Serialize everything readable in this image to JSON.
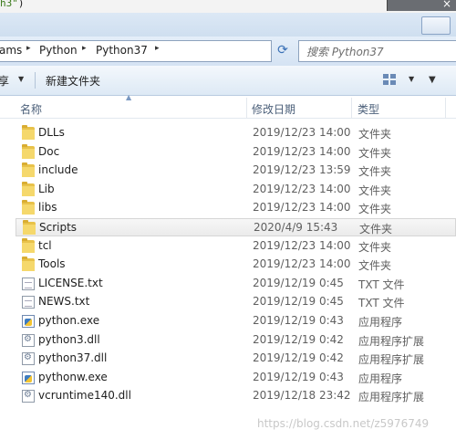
{
  "code": {
    "text_a": "h3\"",
    "text_b": ")"
  },
  "window": {
    "close_glyph": "×"
  },
  "address_bar": {
    "crumbs": [
      "ams",
      "Python",
      "Python37"
    ],
    "separator_glyph": "▸"
  },
  "search": {
    "placeholder": "搜索 Python37"
  },
  "toolbar": {
    "share_label": "享",
    "new_folder_label": "新建文件夹"
  },
  "columns": {
    "name": "名称",
    "date": "修改日期",
    "type": "类型"
  },
  "files": [
    {
      "name": "DLLs",
      "date": "2019/12/23 14:00",
      "type": "文件夹",
      "icon": "folder-icon"
    },
    {
      "name": "Doc",
      "date": "2019/12/23 14:00",
      "type": "文件夹",
      "icon": "folder-icon"
    },
    {
      "name": "include",
      "date": "2019/12/23 13:59",
      "type": "文件夹",
      "icon": "folder-icon"
    },
    {
      "name": "Lib",
      "date": "2019/12/23 14:00",
      "type": "文件夹",
      "icon": "folder-icon"
    },
    {
      "name": "libs",
      "date": "2019/12/23 14:00",
      "type": "文件夹",
      "icon": "folder-icon"
    },
    {
      "name": "Scripts",
      "date": "2020/4/9 15:43",
      "type": "文件夹",
      "icon": "folder-icon",
      "selected": true
    },
    {
      "name": "tcl",
      "date": "2019/12/23 14:00",
      "type": "文件夹",
      "icon": "folder-icon"
    },
    {
      "name": "Tools",
      "date": "2019/12/23 14:00",
      "type": "文件夹",
      "icon": "folder-icon"
    },
    {
      "name": "LICENSE.txt",
      "date": "2019/12/19 0:45",
      "type": "TXT 文件",
      "icon": "text-file-icon"
    },
    {
      "name": "NEWS.txt",
      "date": "2019/12/19 0:45",
      "type": "TXT 文件",
      "icon": "text-file-icon"
    },
    {
      "name": "python.exe",
      "date": "2019/12/19 0:43",
      "type": "应用程序",
      "icon": "python-exe-icon"
    },
    {
      "name": "python3.dll",
      "date": "2019/12/19 0:42",
      "type": "应用程序扩展",
      "icon": "dll-file-icon"
    },
    {
      "name": "python37.dll",
      "date": "2019/12/19 0:42",
      "type": "应用程序扩展",
      "icon": "dll-file-icon"
    },
    {
      "name": "pythonw.exe",
      "date": "2019/12/19 0:43",
      "type": "应用程序",
      "icon": "python-exe-icon"
    },
    {
      "name": "vcruntime140.dll",
      "date": "2019/12/18 23:42",
      "type": "应用程序扩展",
      "icon": "dll-file-icon"
    }
  ],
  "watermark": "https://blog.csdn.net/z5976749"
}
